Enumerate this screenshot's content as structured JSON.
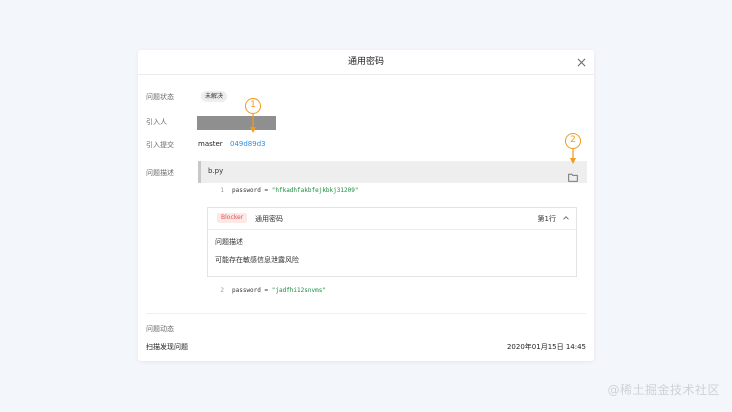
{
  "dialog": {
    "title": "通用密码",
    "close_icon": "close-icon"
  },
  "fields": {
    "status_label": "问题状态",
    "status_value": "未解决",
    "introducer_label": "引入人",
    "commit_label": "引入提交",
    "branch": "master",
    "commit_hash": "049d89d3",
    "description_label": "问题描述"
  },
  "code_panel": {
    "file_name": "b.py",
    "folder_icon": "folder-icon",
    "lines": [
      {
        "no": "1",
        "prefix": "password = ",
        "value": "\"hfkadhfakbfejkbkj31209\""
      },
      {
        "no": "2",
        "prefix": "password = ",
        "value": "\"jadfhi12snvms\""
      }
    ],
    "issue": {
      "severity": "Blocker",
      "title": "通用密码",
      "line_label": "第1行",
      "desc_title": "问题描述",
      "desc_text": "可能存在敏感信息泄露风险"
    }
  },
  "activity": {
    "title": "问题动态",
    "text": "扫描发现问题",
    "time": "2020年01月15日 14:45"
  },
  "annotations": [
    "1",
    "2"
  ],
  "watermark": "@稀土掘金技术社区",
  "colors": {
    "accent_link": "#2f8de4",
    "callout": "#f39a1a",
    "severity_bg": "#fde8e8",
    "severity_text": "#e5504a",
    "code_string": "#1a8c3c"
  }
}
